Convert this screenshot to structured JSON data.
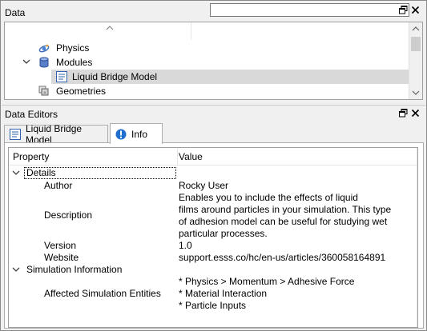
{
  "data_panel": {
    "title": "Data",
    "search": {
      "value": "",
      "placeholder": ""
    },
    "tree": [
      {
        "label": "Physics",
        "icon": "physics-icon"
      },
      {
        "label": "Modules",
        "icon": "database-icon",
        "expanded": true
      },
      {
        "label": "Liquid Bridge Model",
        "icon": "model-form-icon",
        "selected": true
      },
      {
        "label": "Geometries",
        "icon": "geometries-icon"
      }
    ]
  },
  "editors_panel": {
    "title": "Data Editors",
    "tabs": [
      {
        "label": "Liquid Bridge Model",
        "icon": "model-form-icon",
        "active": false
      },
      {
        "label": "Info",
        "icon": "info-icon",
        "active": true
      }
    ],
    "table": {
      "col_property": "Property",
      "col_value": "Value",
      "details": {
        "label": "Details",
        "author_key": "Author",
        "author_value": "Rocky User",
        "description_key": "Description",
        "description_lines": [
          "Enables you to include the effects of liquid",
          "films around particles in your simulation. This type",
          "of adhesion model can be useful for studying wet",
          "particular processes."
        ],
        "version_key": "Version",
        "version_value": "1.0",
        "website_key": "Website",
        "website_value": "support.esss.co/hc/en-us/articles/360058164891"
      },
      "simulation": {
        "label": "Simulation Information",
        "entities_key": "Affected Simulation Entities",
        "entities_lines": [
          "* Physics > Momentum > Adhesive Force",
          "* Material Interaction",
          "* Particle Inputs"
        ]
      }
    }
  },
  "colors": {
    "selection": "#d9d9d9",
    "info_blue": "#1f6fd0",
    "border": "#a0a0a0"
  }
}
